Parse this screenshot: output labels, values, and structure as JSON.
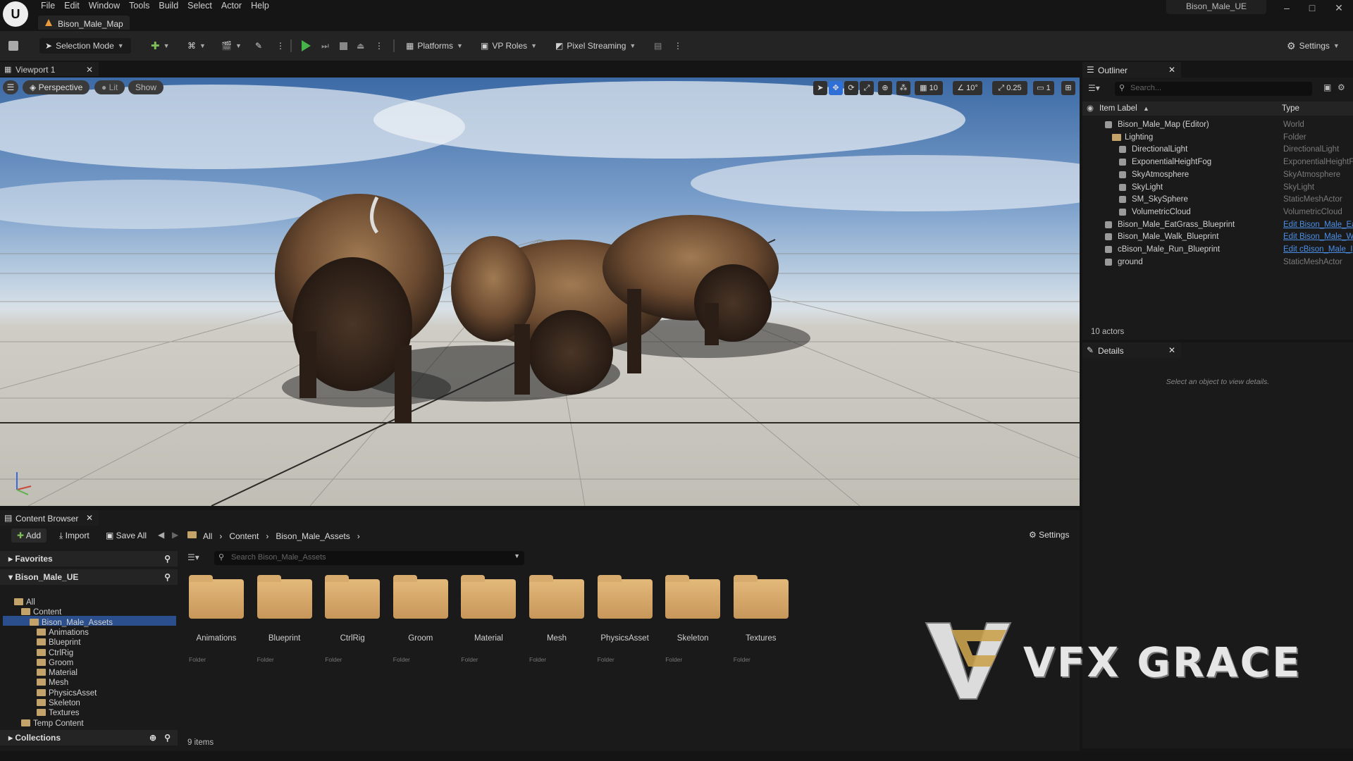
{
  "titlebar": {
    "menu": [
      "File",
      "Edit",
      "Window",
      "Tools",
      "Build",
      "Select",
      "Actor",
      "Help"
    ],
    "doc_tab": "Bison_Male_Map",
    "window_title": "Bison_Male_UE",
    "min": "–",
    "max": "□",
    "close": "✕"
  },
  "toolbar": {
    "selection_mode": "Selection Mode",
    "platforms": "Platforms",
    "vp_roles": "VP Roles",
    "pixel_streaming": "Pixel Streaming",
    "settings": "Settings"
  },
  "viewport": {
    "tab": "Viewport 1",
    "perspective": "Perspective",
    "lit": "Lit",
    "show": "Show",
    "grid": "10",
    "rotation": "10°",
    "scale": "0.25",
    "camera": "1"
  },
  "outliner": {
    "tab": "Outliner",
    "search_placeholder": "Search...",
    "col_label": "Item Label",
    "col_type": "Type",
    "items": [
      {
        "label": "Bison_Male_Map (Editor)",
        "type": "World",
        "icon": "world-icon"
      },
      {
        "label": "Lighting",
        "type": "Folder",
        "icon": "folder-icon"
      },
      {
        "label": "DirectionalLight",
        "type": "DirectionalLight",
        "icon": "directional-light-icon"
      },
      {
        "label": "ExponentialHeightFog",
        "type": "ExponentialHeightF",
        "icon": "fog-icon"
      },
      {
        "label": "SkyAtmosphere",
        "type": "SkyAtmosphere",
        "icon": "sky-atmosphere-icon"
      },
      {
        "label": "SkyLight",
        "type": "SkyLight",
        "icon": "skylight-icon"
      },
      {
        "label": "SM_SkySphere",
        "type": "StaticMeshActor",
        "icon": "static-mesh-icon"
      },
      {
        "label": "VolumetricCloud",
        "type": "VolumetricCloud",
        "icon": "cloud-icon"
      },
      {
        "label": "Bison_Male_EatGrass_Blueprint",
        "type": "Edit Bison_Male_Ea",
        "icon": "blueprint-actor-icon"
      },
      {
        "label": "Bison_Male_Walk_Blueprint",
        "type": "Edit Bison_Male_W",
        "icon": "blueprint-actor-icon"
      },
      {
        "label": "cBison_Male_Run_Blueprint",
        "type": "Edit cBison_Male_I",
        "icon": "blueprint-actor-icon"
      },
      {
        "label": "ground",
        "type": "StaticMeshActor",
        "icon": "static-mesh-icon"
      }
    ],
    "count": "10 actors"
  },
  "details": {
    "tab": "Details",
    "empty": "Select an object to view details."
  },
  "content_browser": {
    "tab": "Content Browser",
    "add": "Add",
    "import": "Import",
    "save_all": "Save All",
    "crumbs": [
      "All",
      "Content",
      "Bison_Male_Assets"
    ],
    "settings": "Settings",
    "favorites": "Favorites",
    "project": "Bison_Male_UE",
    "search_placeholder": "Search Bison_Male_Assets",
    "collections": "Collections",
    "tree": [
      "All",
      "Content",
      "Bison_Male_Assets",
      "Animations",
      "Blueprint",
      "CtrlRig",
      "Groom",
      "Material",
      "Mesh",
      "PhysicsAsset",
      "Skeleton",
      "Textures",
      "Temp Content"
    ],
    "folders": [
      "Animations",
      "Blueprint",
      "CtrlRig",
      "Groom",
      "Material",
      "Mesh",
      "PhysicsAsset",
      "Skeleton",
      "Textures"
    ],
    "folder_type": "Folder",
    "count": "9 items"
  },
  "watermark": {
    "text": "VFX GRACE"
  },
  "colors": {
    "accent": "#2f6fd6",
    "play": "#47b14a",
    "folder": "#d9ab6b",
    "link": "#4c8fe6"
  }
}
